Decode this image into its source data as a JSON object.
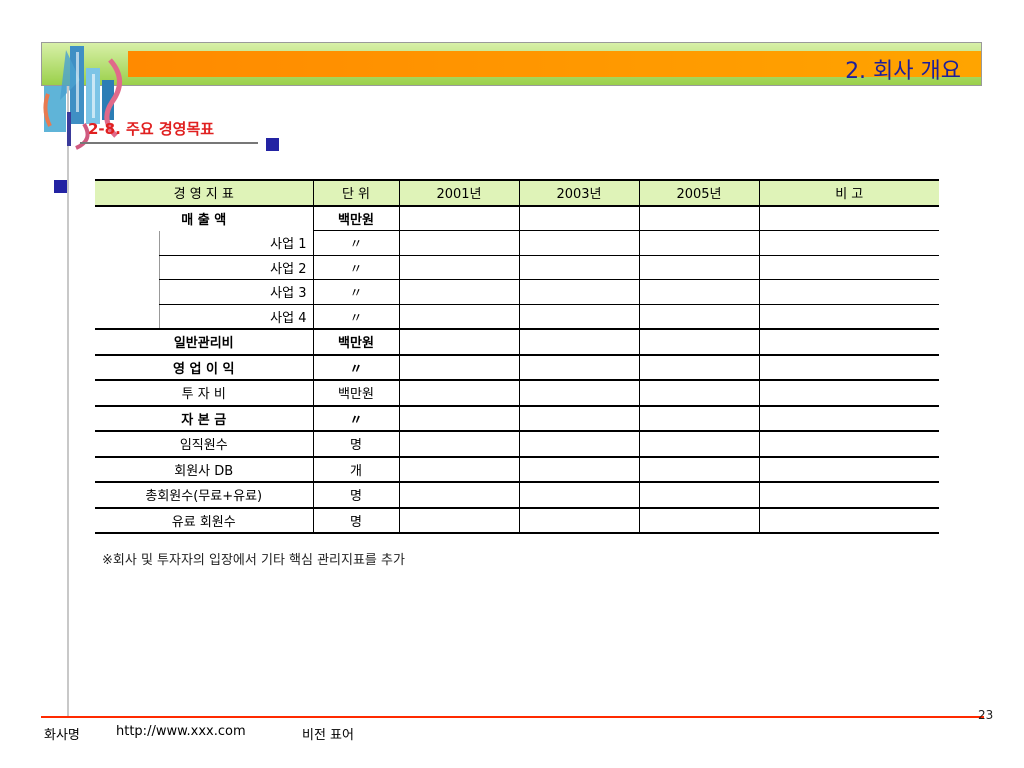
{
  "header": {
    "title": "2. 회사 개요"
  },
  "section": {
    "title": "2-8. 주요 경영목표"
  },
  "table": {
    "headers": [
      "경 영 지 표",
      "단  위",
      "2001년",
      "2003년",
      "2005년",
      "비     고"
    ],
    "rows": [
      {
        "label": "매  출  액",
        "unit": "백만원"
      },
      {
        "label": "사업 1",
        "unit": "〃"
      },
      {
        "label": "사업 2",
        "unit": "〃"
      },
      {
        "label": "사업 3",
        "unit": "〃"
      },
      {
        "label": "사업 4",
        "unit": "〃"
      },
      {
        "label": "일반관리비",
        "unit": "백만원"
      },
      {
        "label": "영 업 이 익",
        "unit": "〃"
      },
      {
        "label": "투 자 비",
        "unit": "백만원"
      },
      {
        "label": "자 본 금",
        "unit": "〃"
      },
      {
        "label": "임직원수",
        "unit": "명"
      },
      {
        "label": "회원사 DB",
        "unit": "개"
      },
      {
        "label": "총회원수(무료+유료)",
        "unit": "명"
      },
      {
        "label": "유료 회원수",
        "unit": "명"
      }
    ]
  },
  "note": "※회사 및 투자자의 입장에서 기타 핵심 관리지표를 추가",
  "footer": {
    "company": "화사명",
    "url": "http://www.xxx.com",
    "vision": "비전 표어",
    "page": "23"
  },
  "colors": {
    "banner_orange": "#ff9600",
    "banner_green": "#9ad04a",
    "title_blue": "#1d1f9a",
    "section_red": "#e02020",
    "accent_square": "#2323a3"
  }
}
